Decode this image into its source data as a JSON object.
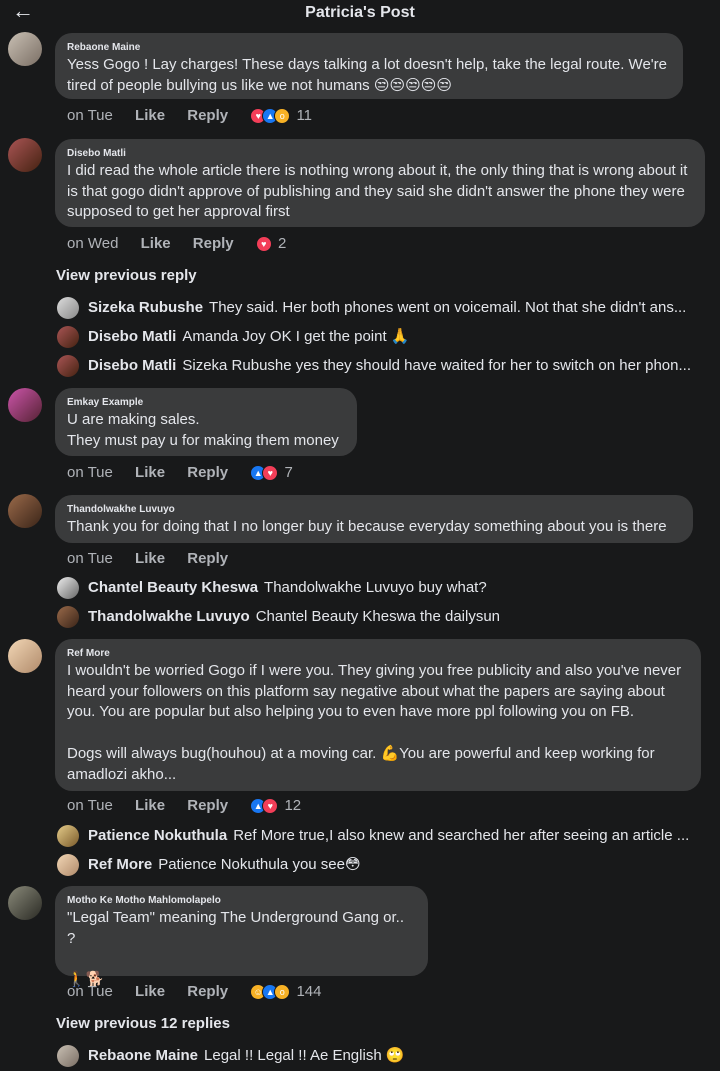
{
  "header": {
    "title": "Patricia's Post",
    "back_icon": "arrow-left-icon"
  },
  "comments": [
    {
      "author": "Rebaone Maine",
      "text": "Yess Gogo ! Lay charges! These days talking a lot doesn't help, take the legal route. We're tired of people bullying us like we not humans 😒😒😒😒😒",
      "time": "on Tue",
      "like": "Like",
      "reply": "Reply",
      "reaction_count": "11",
      "reactions": [
        "love",
        "like",
        "wow"
      ]
    },
    {
      "author": "Disebo Matli",
      "text": "I did read the whole article there is nothing wrong about it, the only thing that is wrong about it  is that gogo didn't approve of publishing and they said she didn't answer the phone they were supposed to get her approval first",
      "time": "on Wed",
      "like": "Like",
      "reply": "Reply",
      "reaction_count": "2",
      "reactions": [
        "love"
      ]
    },
    {
      "author": "Emkay  Example",
      "text": "U are making sales.\nThey must pay u for making them money",
      "time": "on Tue",
      "like": "Like",
      "reply": "Reply",
      "reaction_count": "7",
      "reactions": [
        "like",
        "love"
      ]
    },
    {
      "author": "Thandolwakhe Luvuyo",
      "text": "Thank you for doing that I no longer buy it because everyday something about you is there",
      "time": "on Tue",
      "like": "Like",
      "reply": "Reply"
    },
    {
      "author": "Ref More",
      "text": "I wouldn't be worried Gogo if I were you. They giving you free publicity and also you've never heard your followers on this platform say negative about what the papers are saying about you. You are popular but also helping you to even have more ppl following you on FB.\n\nDogs will always bug(houhou) at a moving car. 💪You are powerful and keep working for amadlozi akho...",
      "time": "on Tue",
      "like": "Like",
      "reply": "Reply",
      "reaction_count": "12",
      "reactions": [
        "like",
        "love"
      ]
    },
    {
      "author": "Motho Ke Motho Mahlomolapelo",
      "text": "\"Legal Team\" meaning The Underground Gang or.. ?\n\n🚶🐕",
      "time": "on Tue",
      "like": "Like",
      "reply": "Reply",
      "reaction_count": "144",
      "reactions": [
        "haha",
        "like",
        "wow"
      ]
    }
  ],
  "view_previous": [
    "View previous reply",
    "View previous 12 replies"
  ],
  "replies": [
    {
      "author": "Sizeka Rubushe",
      "text": "They said. Her both phones went on voicemail. Not that she didn't ans..."
    },
    {
      "author": "Disebo Matli",
      "text": "Amanda Joy OK I get the point 🙏"
    },
    {
      "author": "Disebo Matli",
      "text": "Sizeka Rubushe yes they should have waited for her to switch on her phon..."
    },
    {
      "author": "Chantel Beauty Kheswa",
      "text": "Thandolwakhe Luvuyo buy what?"
    },
    {
      "author": "Thandolwakhe Luvuyo",
      "text": "Chantel Beauty Kheswa the dailysun"
    },
    {
      "author": "Patience Nokuthula",
      "text": "Ref More true,I also knew and searched her after seeing an article ..."
    },
    {
      "author": "Ref More",
      "text": "Patience Nokuthula you see😳"
    },
    {
      "author": "Rebaone Maine",
      "text": "Legal !! Legal !! Ae English 🙄"
    }
  ],
  "colors": {
    "background": "#18191a",
    "bubble": "#3a3b3c",
    "text": "#e4e6eb",
    "muted": "#b0b3b8"
  }
}
